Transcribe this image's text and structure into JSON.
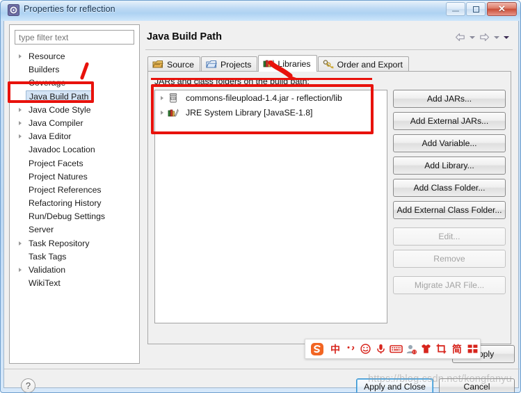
{
  "window": {
    "title": "Properties for reflection",
    "icon": "properties-gear-icon",
    "controls": {
      "minimize": "Minimize",
      "maximize": "Restore",
      "close": "✕"
    }
  },
  "sidebar": {
    "filter": {
      "placeholder": "type filter text",
      "value": ""
    },
    "items": [
      {
        "label": "Resource",
        "expandable": true,
        "selected": false
      },
      {
        "label": "Builders",
        "expandable": false,
        "selected": false
      },
      {
        "label": "Coverage",
        "expandable": false,
        "selected": false
      },
      {
        "label": "Java Build Path",
        "expandable": false,
        "selected": true
      },
      {
        "label": "Java Code Style",
        "expandable": true,
        "selected": false
      },
      {
        "label": "Java Compiler",
        "expandable": true,
        "selected": false
      },
      {
        "label": "Java Editor",
        "expandable": true,
        "selected": false
      },
      {
        "label": "Javadoc Location",
        "expandable": false,
        "selected": false
      },
      {
        "label": "Project Facets",
        "expandable": false,
        "selected": false
      },
      {
        "label": "Project Natures",
        "expandable": false,
        "selected": false
      },
      {
        "label": "Project References",
        "expandable": false,
        "selected": false
      },
      {
        "label": "Refactoring History",
        "expandable": false,
        "selected": false
      },
      {
        "label": "Run/Debug Settings",
        "expandable": false,
        "selected": false
      },
      {
        "label": "Server",
        "expandable": false,
        "selected": false
      },
      {
        "label": "Task Repository",
        "expandable": true,
        "selected": false
      },
      {
        "label": "Task Tags",
        "expandable": false,
        "selected": false
      },
      {
        "label": "Validation",
        "expandable": true,
        "selected": false
      },
      {
        "label": "WikiText",
        "expandable": false,
        "selected": false
      }
    ]
  },
  "page": {
    "title": "Java Build Path",
    "nav": {
      "back_icon": "back-arrow-icon",
      "back_menu_icon": "chevron-down-icon",
      "forward_icon": "forward-arrow-icon",
      "forward_menu_icon": "chevron-down-icon",
      "view_menu_icon": "chevron-down-icon"
    }
  },
  "tabs": [
    {
      "label": "Source",
      "icon": "source-folder-icon",
      "active": false
    },
    {
      "label": "Projects",
      "icon": "project-folder-icon",
      "active": false
    },
    {
      "label": "Libraries",
      "icon": "libraries-books-icon",
      "active": true
    },
    {
      "label": "Order and Export",
      "icon": "order-export-icon",
      "active": false
    }
  ],
  "libraries": {
    "list_label": "JARs and class folders on the build path:",
    "entries": [
      {
        "label": "commons-fileupload-1.4.jar - reflection/lib",
        "icon": "jar-icon",
        "expandable": true
      },
      {
        "label": "JRE System Library [JavaSE-1.8]",
        "icon": "library-books-icon",
        "expandable": true
      }
    ],
    "buttons": [
      {
        "label": "Add JARs...",
        "enabled": true,
        "mnemonic": "J"
      },
      {
        "label": "Add External JARs...",
        "enabled": true,
        "mnemonic": "x"
      },
      {
        "label": "Add Variable...",
        "enabled": true,
        "mnemonic": "V"
      },
      {
        "label": "Add Library...",
        "enabled": true,
        "mnemonic": "i"
      },
      {
        "label": "Add Class Folder...",
        "enabled": true,
        "mnemonic": "C"
      },
      {
        "label": "Add External Class Folder...",
        "enabled": true,
        "mnemonic": "d"
      },
      {
        "label": "Edit...",
        "enabled": false,
        "mnemonic": "E",
        "gap": true
      },
      {
        "label": "Remove",
        "enabled": false,
        "mnemonic": "R"
      },
      {
        "label": "Migrate JAR File...",
        "enabled": false,
        "mnemonic": "g",
        "gap": true
      }
    ]
  },
  "footer": {
    "help_icon": "help-question-icon",
    "apply": "Apply",
    "apply_and_close": "Apply and Close",
    "cancel": "Cancel"
  },
  "ime_toolbar": {
    "name": "sogou-input-method-toolbar",
    "items": [
      {
        "icon": "sogou-logo-icon",
        "glyph": ""
      },
      {
        "icon": "chinese-mode-icon",
        "glyph": "中"
      },
      {
        "icon": "punctuation-mode-icon",
        "glyph": "·,"
      },
      {
        "icon": "emoji-icon",
        "glyph": "☺"
      },
      {
        "icon": "voice-input-icon",
        "glyph": "🎤"
      },
      {
        "icon": "soft-keyboard-icon",
        "glyph": "⌨"
      },
      {
        "icon": "user-account-icon",
        "glyph": "👤"
      },
      {
        "icon": "skin-shirt-icon",
        "glyph": "👕"
      },
      {
        "icon": "screenshot-crop-icon",
        "glyph": "⊐"
      },
      {
        "icon": "simplified-chinese-icon",
        "glyph": "简"
      },
      {
        "icon": "toolbox-grid-icon",
        "glyph": "▦"
      }
    ]
  },
  "annotations": {
    "sidebar_highlight": "red-box-java-build-path",
    "list_highlight": "red-box-jar-list",
    "tab_arrow": "red-arrow-to-libraries-tab",
    "label_underline": "red-underline-jars-label",
    "slash_mark": "red-slash-mark"
  },
  "watermark": {
    "text": "https://blog.csdn.net/kongfanyu"
  }
}
